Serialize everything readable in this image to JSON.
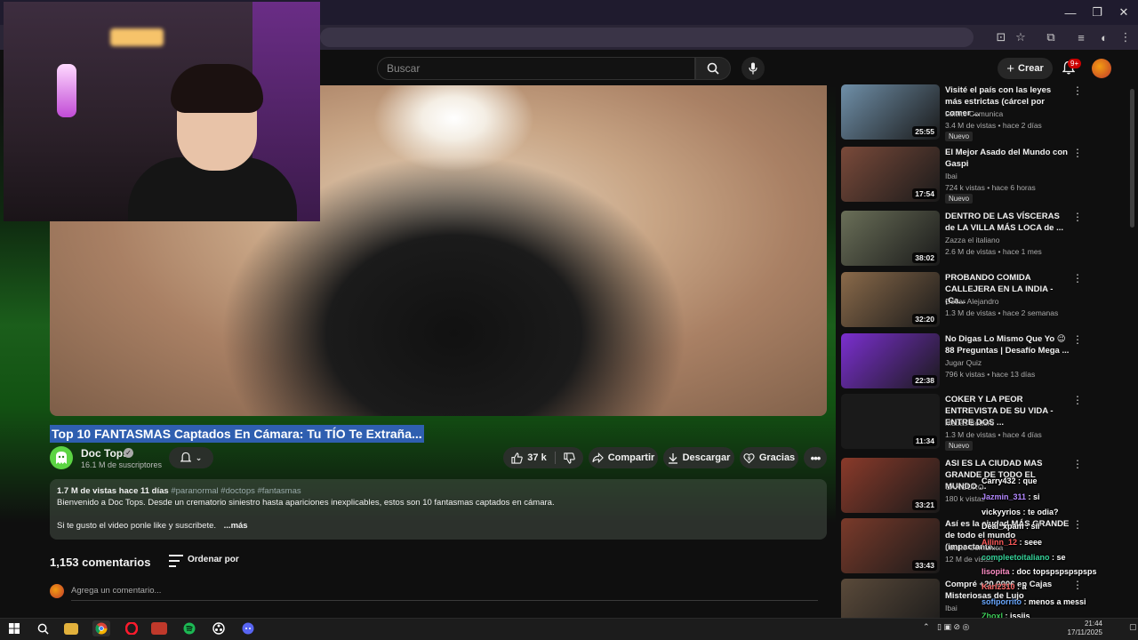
{
  "browser": {
    "window_controls": {
      "minimize": "—",
      "restore": "❐",
      "close": "✕"
    }
  },
  "header": {
    "search_placeholder": "Buscar",
    "create_label": "Crear",
    "notification_count": "9+"
  },
  "video": {
    "title": "Top 10 FANTASMAS Captados En Cámara: Tu TÍO Te Extraña...",
    "channel": "Doc Tops",
    "subscribers": "16.1 M de suscriptores",
    "likes": "37 k",
    "share_label": "Compartir",
    "download_label": "Descargar",
    "thanks_label": "Gracias"
  },
  "description": {
    "meta": "1.7 M de vistas  hace 11 días",
    "tags": "#paranormal #doctops #fantasmas",
    "line1": "Bienvenido a Doc Tops.  Desde un crematorio siniestro hasta apariciones inexplicables, estos son 10 fantasmas captados en cámara.",
    "line2": "Si te gusto el video ponle like y suscribete.",
    "more": "...más"
  },
  "comments": {
    "count": "1,153 comentarios",
    "sort_label": "Ordenar por",
    "placeholder": "Agrega un comentario..."
  },
  "recommendations": [
    {
      "title": "Visité el país con las leyes más estrictas (cárcel por comer ...",
      "channel": "Luisito Comunica",
      "stats": "3.4 M de vistas • hace 2 días",
      "duration": "25:55",
      "badge": "Nuevo",
      "color": "#6f8fa8"
    },
    {
      "title": "El Mejor Asado del Mundo con Gaspi",
      "channel": "Ibai",
      "stats": "724 k vistas • hace 6 horas",
      "duration": "17:54",
      "badge": "Nuevo",
      "color": "#7a4a3a"
    },
    {
      "title": "DENTRO DE LAS VÍSCERAS de LA VILLA MÁS LOCA de ...",
      "channel": "Zazza el italiano",
      "stats": "2.6 M de vistas • hace 1 mes",
      "duration": "38:02",
      "badge": "",
      "color": "#6a6f58"
    },
    {
      "title": "PROBANDO COMIDA CALLEJERA EN LA INDIA - ¡Ca...",
      "channel": "Oscar Alejandro",
      "stats": "1.3 M de vistas • hace 2 semanas",
      "duration": "32:20",
      "badge": "",
      "color": "#8a6a4a"
    },
    {
      "title": "No Digas Lo Mismo Que Yo 😉 88 Preguntas | Desafío Mega ...",
      "channel": "Jugar Quiz",
      "stats": "796 k vistas • hace 13 días",
      "duration": "22:38",
      "badge": "",
      "color": "#7b2fd0"
    },
    {
      "title": "COKER Y LA PEOR ENTREVISTA DE SU VIDA - ENTRE DOS ...",
      "channel": "Matías Bottero",
      "stats": "1.3 M de vistas • hace 4 días",
      "duration": "11:34",
      "badge": "Nuevo",
      "color": "#1a1a1a"
    },
    {
      "title": "ASI ES LA CIUDAD MAS GRANDE DE TODO EL MUNDO ...",
      "channel": "CANGURO",
      "stats": "180 k vistas",
      "duration": "33:21",
      "badge": "",
      "color": "#8a3a2a"
    },
    {
      "title": "Así es la ciudad MÁS GRANDE de todo el mundo (impactante...",
      "channel": "Luisito Comunica",
      "stats": "12 M de vistas",
      "duration": "33:43",
      "badge": "",
      "color": "#7a3a2a"
    },
    {
      "title": "Compré +20.000€ en Cajas Misteriosas de Lujo",
      "channel": "Ibai",
      "stats": "",
      "duration": "",
      "badge": "",
      "color": "#5a4a3a"
    }
  ],
  "chat": [
    {
      "user": "Carry432",
      "msg": "que",
      "color": "#ffffff"
    },
    {
      "user": "Jazmin_311",
      "msg": "si",
      "color": "#b388ff"
    },
    {
      "user": "vickyyrios",
      "msg": "te odia?",
      "color": "#ffffff"
    },
    {
      "user": "Deal_xpam",
      "msg": "sii",
      "color": "#ffffff"
    },
    {
      "user": "Ailinn_12",
      "msg": "seee",
      "color": "#ff5b5b"
    },
    {
      "user": "compleetoitaliano",
      "msg": "se",
      "color": "#36d39a"
    },
    {
      "user": "lisopita",
      "msg": "doc topspspspspsps",
      "color": "#ff8fc7"
    },
    {
      "user": "Karl2310",
      "msg": "a",
      "color": "#ff6b6b"
    },
    {
      "user": "sofiporrito",
      "msg": "menos a messi",
      "color": "#6aa8ff"
    },
    {
      "user": "Zhoxl",
      "msg": "issiis",
      "color": "#3fcf5a"
    },
    {
      "user": "churrosglaseados26",
      "msg": "Sí",
      "color": "#ffffff"
    }
  ],
  "taskbar": {
    "time": "21:44",
    "date": "17/11/2025"
  }
}
